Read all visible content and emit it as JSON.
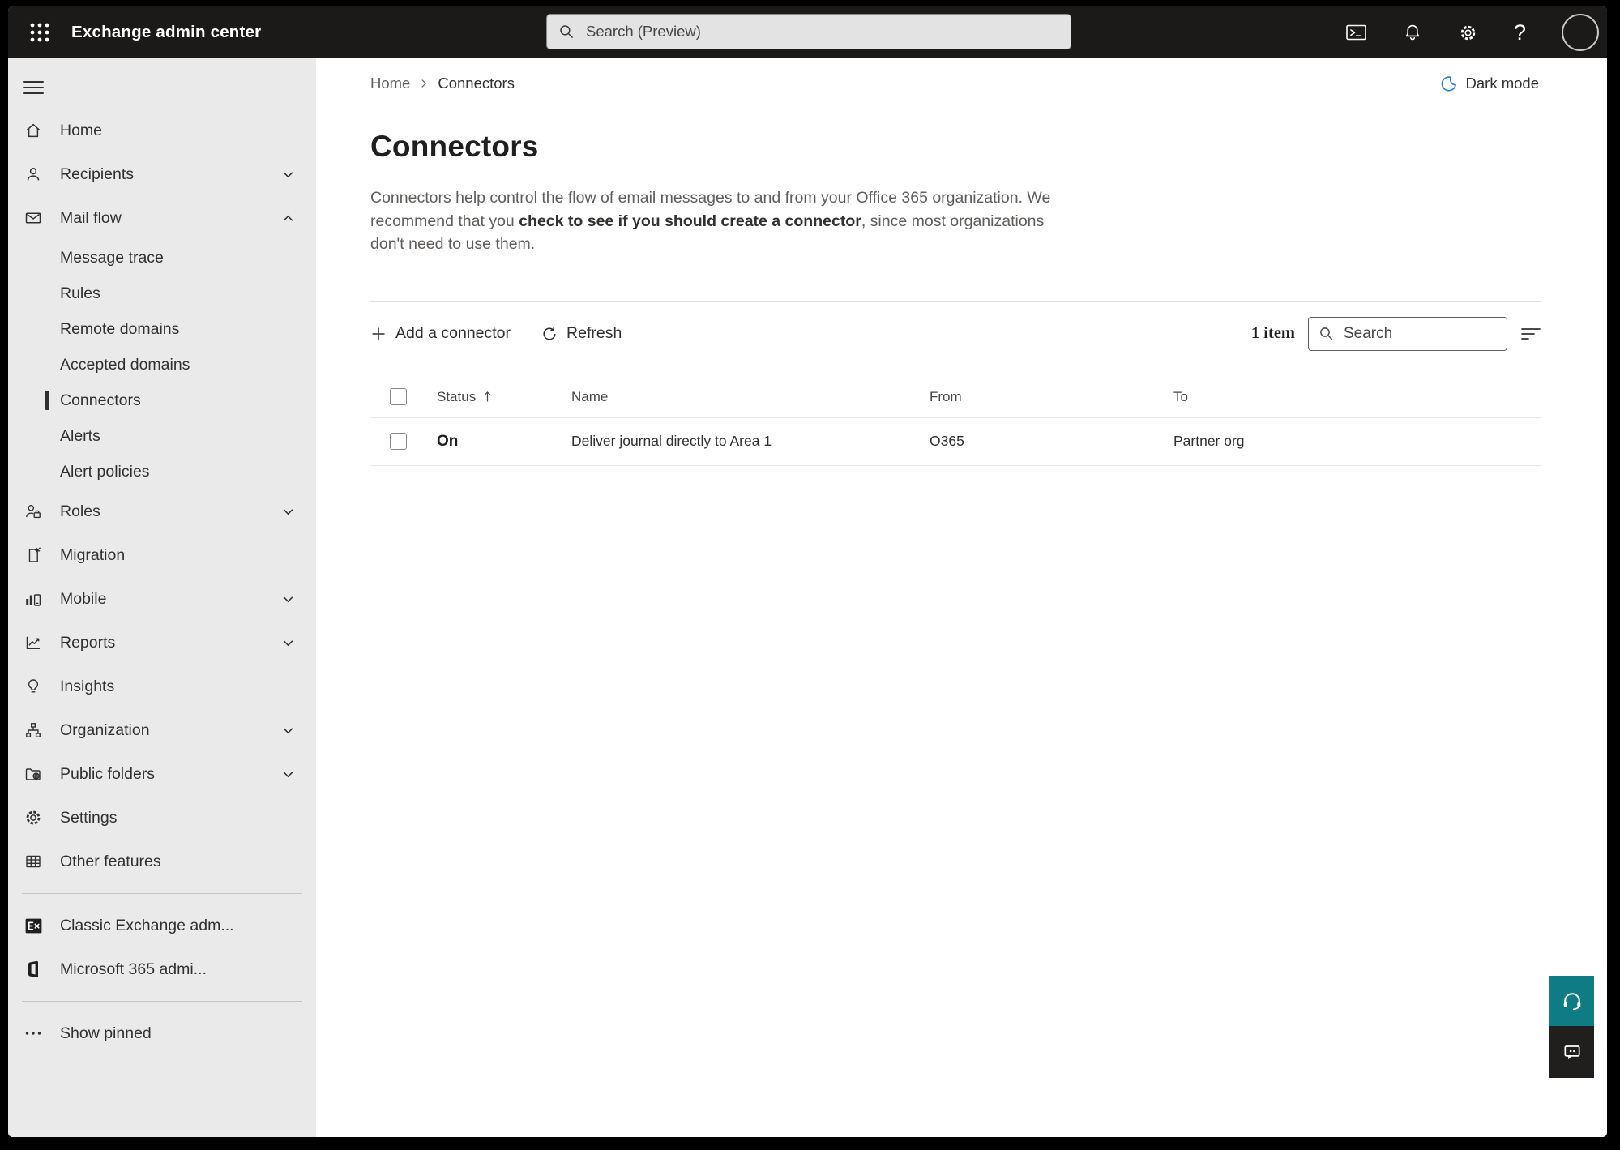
{
  "topbar": {
    "app_title": "Exchange admin center",
    "search_placeholder": "Search (Preview)",
    "help_glyph": "?",
    "icons": [
      "app-launcher",
      "cloud-shell-terminal",
      "notifications-bell",
      "settings-gear",
      "help",
      "account-avatar"
    ]
  },
  "breadcrumb": {
    "home": "Home",
    "current": "Connectors"
  },
  "theme_toggle": {
    "label": "Dark mode",
    "icon": "moon",
    "icon_color": "#2b7cd3"
  },
  "page": {
    "title": "Connectors",
    "description_pre": "Connectors help control the flow of email messages to and from your Office 365 organization. We recommend that you ",
    "description_emphasis": "check to see if you should create a connector",
    "description_post": ", since most organizations don't need to use them."
  },
  "toolbar": {
    "add_label": "Add a connector",
    "refresh_label": "Refresh",
    "item_count": "1 item",
    "search_placeholder": "Search"
  },
  "table": {
    "headers": {
      "status": "Status",
      "name": "Name",
      "from": "From",
      "to": "To"
    },
    "rows": [
      {
        "status": "On",
        "name": "Deliver journal directly to Area 1",
        "from": "O365",
        "to": "Partner org"
      }
    ]
  },
  "sidebar": {
    "items": [
      {
        "label": "Home",
        "icon": "home",
        "type": "top"
      },
      {
        "label": "Recipients",
        "icon": "person",
        "type": "top",
        "chevron": "down"
      },
      {
        "label": "Mail flow",
        "icon": "mail",
        "type": "top",
        "chevron": "up",
        "expanded": true
      },
      {
        "label": "Message trace",
        "type": "sub"
      },
      {
        "label": "Rules",
        "type": "sub"
      },
      {
        "label": "Remote domains",
        "type": "sub"
      },
      {
        "label": "Accepted domains",
        "type": "sub"
      },
      {
        "label": "Connectors",
        "type": "sub",
        "selected": true
      },
      {
        "label": "Alerts",
        "type": "sub"
      },
      {
        "label": "Alert policies",
        "type": "sub"
      },
      {
        "label": "Roles",
        "icon": "person-briefcase",
        "type": "top",
        "chevron": "down"
      },
      {
        "label": "Migration",
        "icon": "document-arrow",
        "type": "top"
      },
      {
        "label": "Mobile",
        "icon": "chart-phone",
        "type": "top",
        "chevron": "down"
      },
      {
        "label": "Reports",
        "icon": "line-chart",
        "type": "top",
        "chevron": "down"
      },
      {
        "label": "Insights",
        "icon": "lightbulb",
        "type": "top"
      },
      {
        "label": "Organization",
        "icon": "org-chart",
        "type": "top",
        "chevron": "down"
      },
      {
        "label": "Public folders",
        "icon": "folder-globe",
        "type": "top",
        "chevron": "down"
      },
      {
        "label": "Settings",
        "icon": "gear",
        "type": "top"
      },
      {
        "label": "Other features",
        "icon": "grid-table",
        "type": "top"
      },
      {
        "label": "Classic Exchange adm...",
        "icon": "exchange-logo",
        "type": "external-link"
      },
      {
        "label": "Microsoft 365 admi...",
        "icon": "microsoft-365-logo",
        "type": "external-link"
      },
      {
        "label": "Show pinned",
        "icon": "ellipsis",
        "type": "action"
      }
    ]
  },
  "floating_buttons": [
    {
      "name": "support",
      "icon": "headset",
      "color": "#0f7b84"
    },
    {
      "name": "feedback",
      "icon": "chat-bubble",
      "color": "#201f1e"
    }
  ],
  "colors": {
    "topbar_bg": "#1b1a19",
    "sidebar_bg": "#eaeaea",
    "selected_marker": "#323130",
    "teal_accent": "#0f7b84",
    "moon_blue": "#2b7cd3",
    "text_gray": "#605e5c",
    "text_dark": "#323130"
  }
}
